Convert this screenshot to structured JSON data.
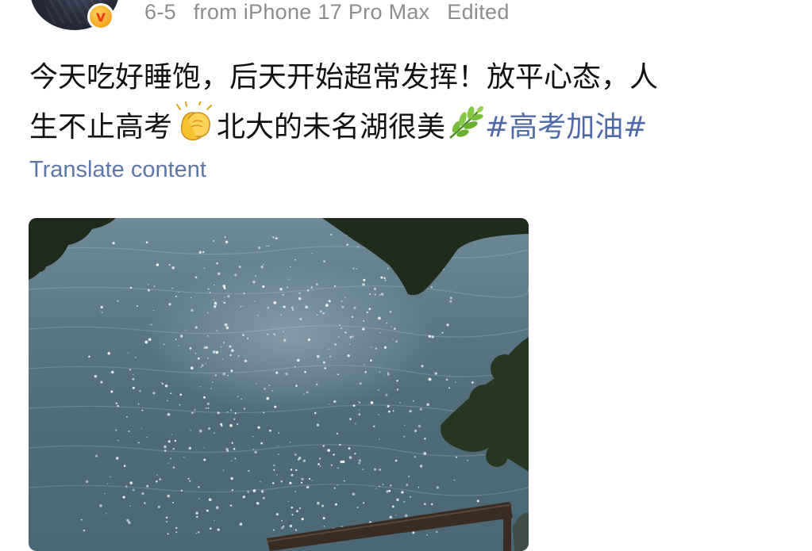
{
  "header": {
    "date": "6-5",
    "source": "from iPhone 17 Pro Max",
    "edited": "Edited",
    "badge_letter": "v"
  },
  "post": {
    "line1": "今天吃好睡饱，后天开始超常发挥！放平心态，人",
    "line2_a": "生不止高考",
    "line2_b": "北大的未名湖很美",
    "hashtag": "#高考加油#",
    "emojis": [
      "clapping-hands-icon",
      "herb-icon"
    ]
  },
  "translate": {
    "label": "Translate content"
  },
  "colors": {
    "link": "#5d76a8",
    "hashtag": "#4e6aa6",
    "meta": "#8d8d8d",
    "badge": "#f5a623"
  }
}
